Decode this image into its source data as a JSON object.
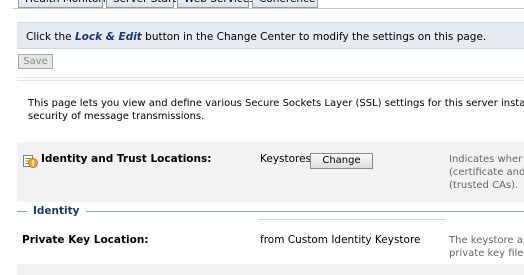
{
  "tabs": [
    {
      "label": "Health Monitoring"
    },
    {
      "label": "Server Start"
    },
    {
      "label": "Web Services"
    },
    {
      "label": "Coherence"
    }
  ],
  "banner": {
    "prefix": "Click the ",
    "strong": "Lock & Edit",
    "suffix": " button in the Change Center to modify the settings on this page."
  },
  "toolbar": {
    "save_label": "Save"
  },
  "description": {
    "line1": "This page lets you view and define various Secure Sockets Layer (SSL) settings for this server instance",
    "line2": "security of message transmissions."
  },
  "identity_trust": {
    "icon": "info-help-icon",
    "label": "Identity and Trust Locations:",
    "value": "Keystores",
    "change_label": "Change",
    "help": [
      "Indicates wher",
      "(certificate and",
      "(trusted CAs)."
    ]
  },
  "identity_section": {
    "title": "Identity"
  },
  "private_key": {
    "label": "Private Key Location:",
    "value": "from Custom Identity Keystore",
    "help": [
      "The keystore a",
      "private key file"
    ]
  },
  "colors": {
    "banner_bg": "#e6ebf4",
    "row_bg": "#f2f2f2",
    "section_title": "#1c3868",
    "help_text": "#666666"
  }
}
